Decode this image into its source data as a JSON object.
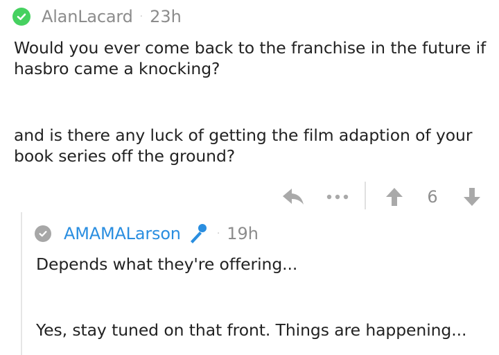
{
  "comment": {
    "author": "AlanLacard",
    "separator": "·",
    "time": "23h",
    "paragraphs": [
      "Would you ever come back to the franchise in the future if hasbro came a knocking?",
      "and is there any luck of getting the film adaption of your book series off the ground?"
    ],
    "score": "6",
    "actions": {
      "reply_icon": "reply-arrow-icon",
      "more_icon": "more-dots-icon",
      "upvote_icon": "upvote-arrow-icon",
      "downvote_icon": "downvote-arrow-icon"
    }
  },
  "reply": {
    "author": "AMAMALarson",
    "badge_icon": "microphone-icon",
    "separator": "·",
    "time": "19h",
    "paragraphs": [
      "Depends what they're offering...",
      "Yes, stay tuned on that front. Things are happening..."
    ]
  },
  "colors": {
    "verified_green": "#46d160",
    "verified_grey": "#a7a7a7",
    "op_blue": "#2a8ee0",
    "muted_text": "#8c8c8c",
    "body_text": "#222222"
  }
}
